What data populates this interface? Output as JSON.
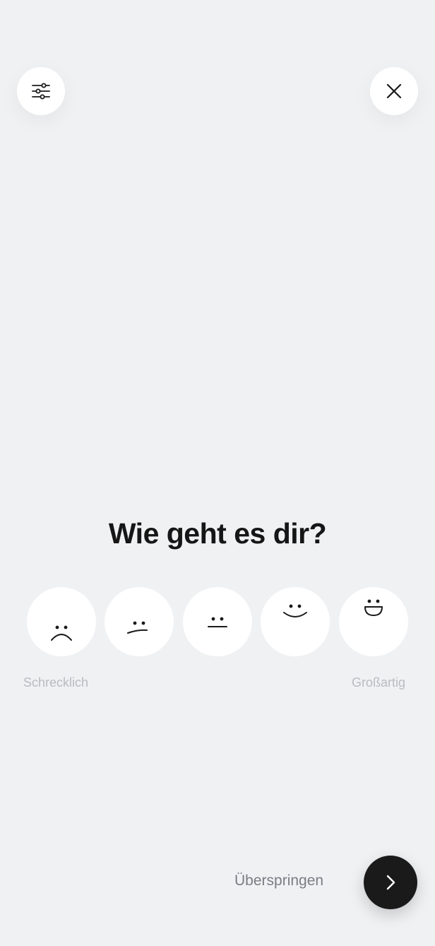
{
  "header": {
    "filter_icon": "sliders-icon",
    "close_icon": "close-icon"
  },
  "question": "Wie geht es dir?",
  "moods": [
    {
      "id": "terrible",
      "icon": "very-sad-face-icon"
    },
    {
      "id": "bad",
      "icon": "sad-face-icon"
    },
    {
      "id": "okay",
      "icon": "neutral-face-icon"
    },
    {
      "id": "good",
      "icon": "smile-face-icon"
    },
    {
      "id": "great",
      "icon": "big-smile-face-icon"
    }
  ],
  "scale": {
    "low_label": "Schrecklich",
    "high_label": "Großartig"
  },
  "footer": {
    "skip_label": "Überspringen",
    "next_icon": "chevron-right-icon"
  },
  "colors": {
    "background": "#f0f1f3",
    "card": "#ffffff",
    "text_primary": "#161616",
    "text_muted": "#b9bbbf",
    "button_dark": "#1a1a1a"
  }
}
